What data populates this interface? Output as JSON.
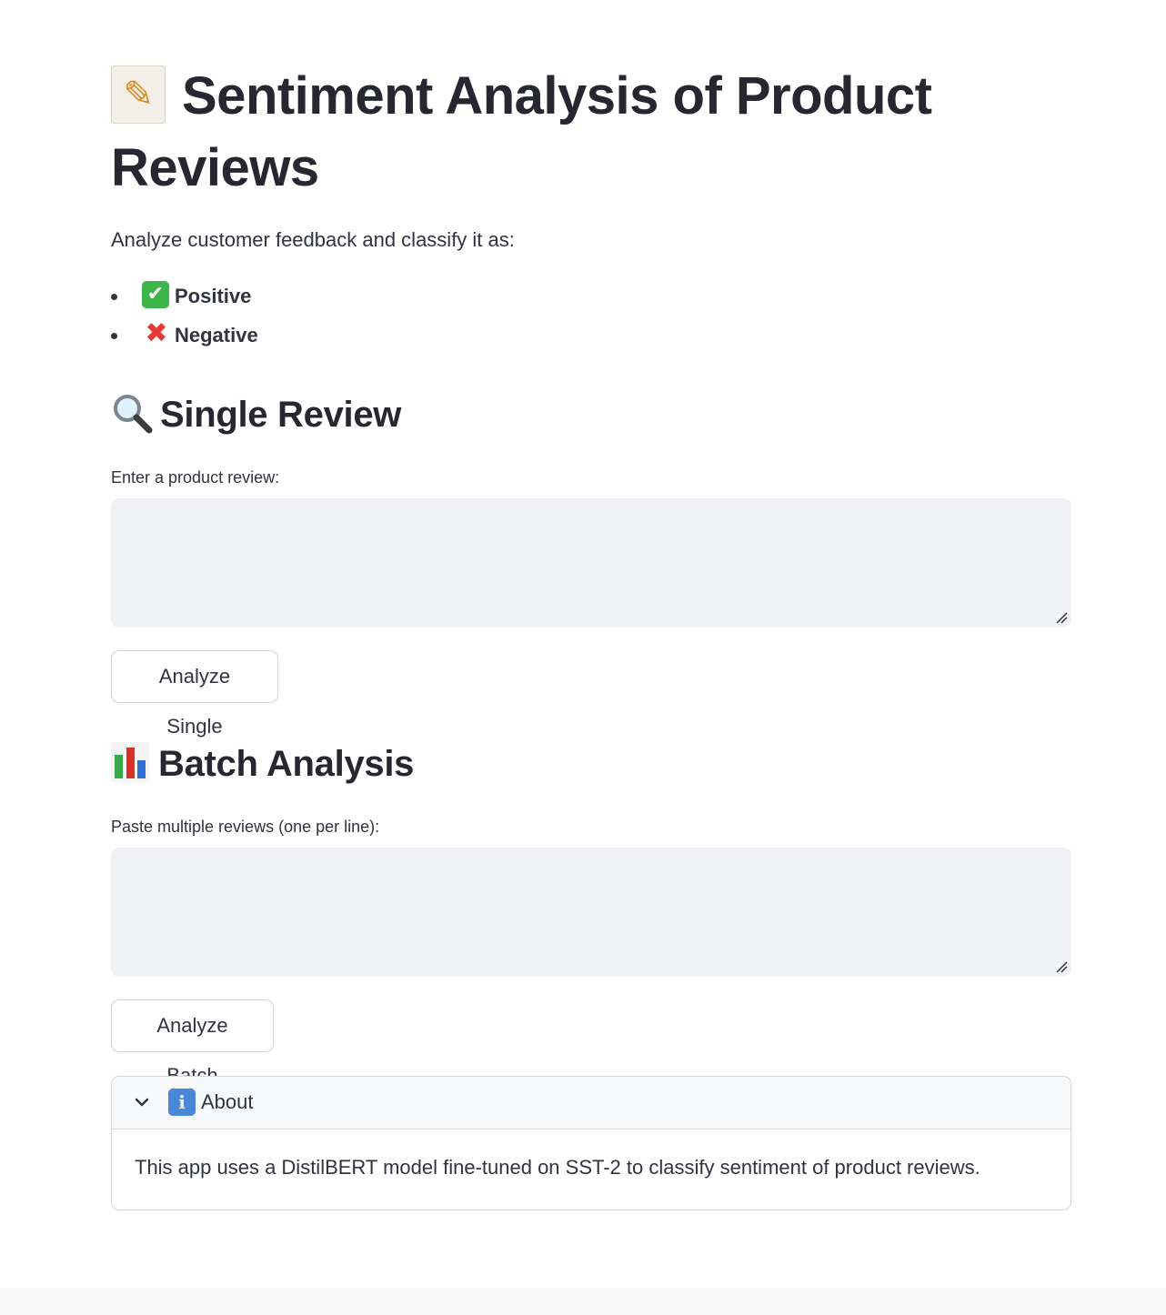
{
  "header": {
    "title": "Sentiment Analysis of Product Reviews",
    "title_icon": "memo-pencil-icon"
  },
  "intro": {
    "text": "Analyze customer feedback and classify it as:",
    "classes": [
      {
        "label": "Positive",
        "icon": "check-mark-icon",
        "color": "#3db54a"
      },
      {
        "label": "Negative",
        "icon": "cross-mark-icon",
        "color": "#e53935"
      }
    ]
  },
  "single": {
    "heading": "Single Review",
    "icon": "magnifier-icon",
    "field_label": "Enter a product review:",
    "value": "",
    "button_label": "Analyze Single"
  },
  "batch": {
    "heading": "Batch Analysis",
    "icon": "bar-chart-icon",
    "field_label": "Paste multiple reviews (one per line):",
    "value": "",
    "button_label": "Analyze Batch"
  },
  "about": {
    "title": "About",
    "icon": "information-icon",
    "expanded": true,
    "body": "This app uses a DistilBERT model fine-tuned on SST-2 to classify sentiment of product reviews."
  },
  "colors": {
    "text": "#31333f",
    "heading": "#262730",
    "input_background": "#f0f2f6",
    "border": "#d4d6dc"
  }
}
